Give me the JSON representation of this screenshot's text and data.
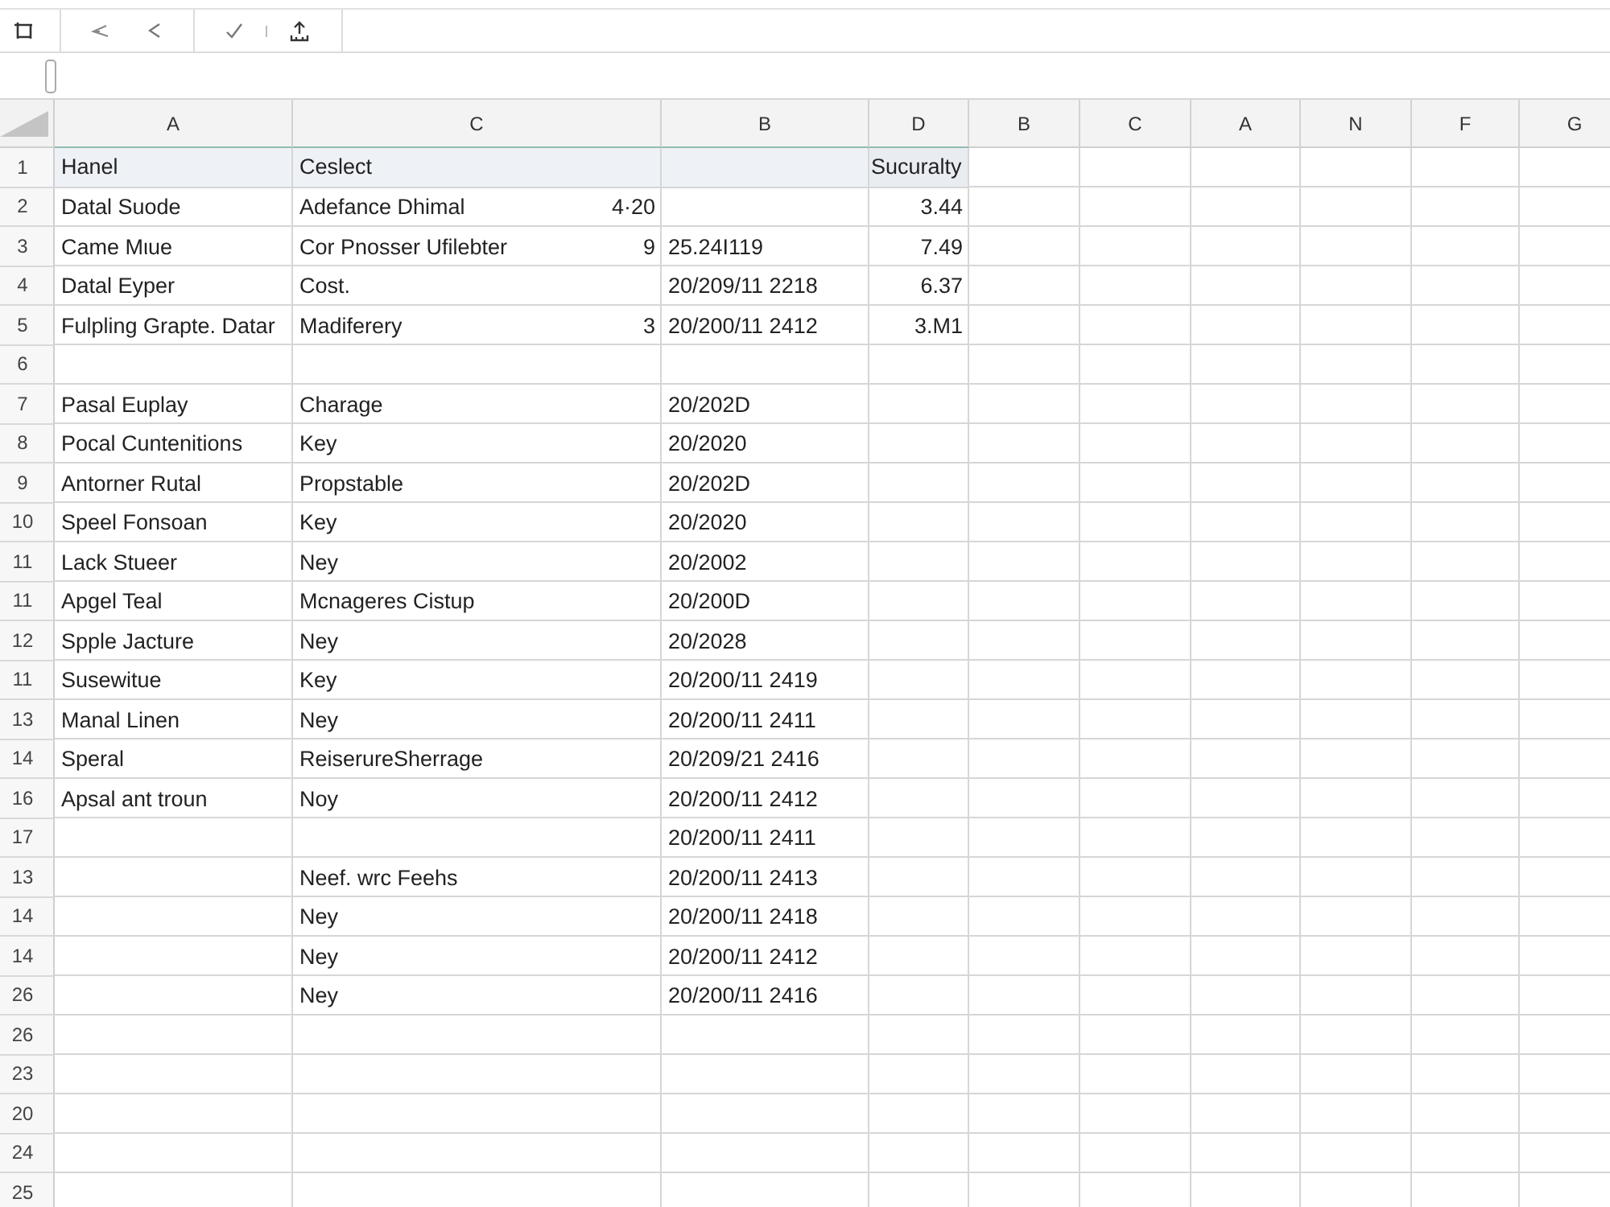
{
  "columns": [
    "A",
    "C",
    "B",
    "D",
    "B",
    "C",
    "A",
    "N",
    "F",
    "G"
  ],
  "header_row": {
    "number": "1",
    "column_1": "Hanel",
    "column_2": "Ceslect",
    "column_4": "Sucuralty"
  },
  "rows": [
    {
      "number": "2",
      "column_1": "Datal Suode",
      "column_2": "Adefance Dhimal",
      "column_2_figure": "4·20",
      "column_4": "3.44"
    },
    {
      "number": "3",
      "column_1": "Came Mιue",
      "column_2": "Cor Pnosser Ufilebter",
      "column_2_figure": "9",
      "column_3": "25.24I119",
      "column_4": "7.49"
    },
    {
      "number": "4",
      "column_1": "Datal Eyper",
      "column_2": "Cost.",
      "column_3": "20/209/11 2218",
      "column_4": "6.37"
    },
    {
      "number": "5",
      "column_1": "Fulpling Grapte. Datar",
      "column_2": "Madiferery",
      "column_2_figure": "3",
      "column_3": "20/200/11 2412",
      "column_4": "3.M1"
    },
    {
      "number": "6"
    },
    {
      "number": "7",
      "column_1": "Pasal Euplay",
      "column_2": "Charage",
      "column_3": "20/202D"
    },
    {
      "number": "8",
      "column_1": "Pocal Cuntenitions",
      "column_2": "Key",
      "column_3": "20/2020"
    },
    {
      "number": "9",
      "column_1": "Antorner Rutal",
      "column_2": "Propstable",
      "column_3": "20/202D"
    },
    {
      "number": "10",
      "column_1": "Speel Fonsoan",
      "column_2": "Key",
      "column_3": "20/2020"
    },
    {
      "number": "11",
      "column_1": "Lack Stueer",
      "column_2": "Ney",
      "column_3": "20/2002"
    },
    {
      "number": "11",
      "column_1": "Apgel Teal",
      "column_2": "Mcnageres Cistup",
      "column_3": "20/200D"
    },
    {
      "number": "12",
      "column_1": "Spple Jacture",
      "column_2": "Ney",
      "column_3": "20/2028"
    },
    {
      "number": "11",
      "column_1": "Susewitue",
      "column_2": "Key",
      "column_3": "20/200/11 2419"
    },
    {
      "number": "13",
      "column_1": "Manal Linen",
      "column_2": "Ney",
      "column_3": "20/200/11 2411"
    },
    {
      "number": "14",
      "column_1": "Speral",
      "column_2": "ReiserureSherrage",
      "column_3": "20/209/21 2416"
    },
    {
      "number": "16",
      "column_1": "Apsal ant troun",
      "column_2": "Noy",
      "column_3": "20/200/11 2412"
    },
    {
      "number": "17",
      "column_3": "20/200/11 2411"
    },
    {
      "number": "13",
      "column_2": "Neef. wrc Feehs",
      "column_3": "20/200/11 2413"
    },
    {
      "number": "14",
      "column_2": "Ney",
      "column_3": "20/200/11 2418"
    },
    {
      "number": "14",
      "column_2": "Ney",
      "column_3": "20/200/11 2412"
    },
    {
      "number": "26",
      "column_2": "Ney",
      "column_3": "20/200/11 2416"
    },
    {
      "number": "26"
    },
    {
      "number": "23"
    },
    {
      "number": "20"
    },
    {
      "number": "24"
    },
    {
      "number": "25"
    }
  ]
}
